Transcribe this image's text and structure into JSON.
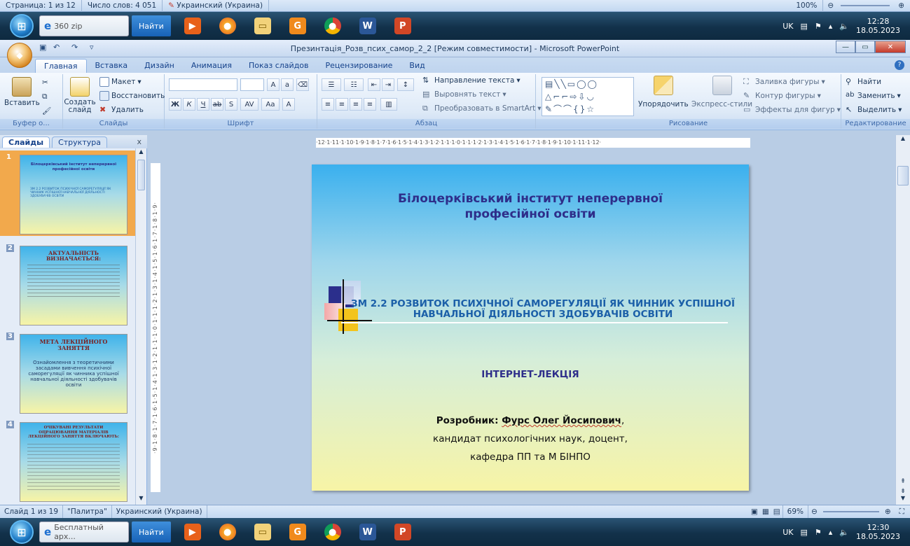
{
  "top_status": {
    "page": "Страница: 1 из 12",
    "words": "Число слов: 4 051",
    "language": "Украинский (Украина)",
    "zoom": "100%"
  },
  "taskbar_top": {
    "search_value": "360 zip",
    "search_button": "Найти",
    "tray_lang": "UK",
    "time": "12:28",
    "date": "18.05.2023"
  },
  "window": {
    "title": "Презинтація_Розв_псих_самор_2_2 [Режим совместимости] - Microsoft PowerPoint"
  },
  "ribbon_tabs": [
    "Главная",
    "Вставка",
    "Дизайн",
    "Анимация",
    "Показ слайдов",
    "Рецензирование",
    "Вид"
  ],
  "ribbon": {
    "paste": "Вставить",
    "clipboard_group": "Буфер о...",
    "layout": "Макет",
    "reset": "Восстановить",
    "new_slide": "Создать слайд",
    "delete": "Удалить",
    "slides_group": "Слайды",
    "font_group": "Шрифт",
    "text_direction": "Направление текста",
    "align_text": "Выровнять текст",
    "smartart": "Преобразовать в SmartArt",
    "paragraph_group": "Абзац",
    "arrange": "Упорядочить",
    "quick_styles": "Экспресс-стили",
    "shape_fill": "Заливка фигуры",
    "shape_outline": "Контур фигуры",
    "shape_effects": "Эффекты для фигур",
    "drawing_group": "Рисование",
    "find": "Найти",
    "replace": "Заменить",
    "select": "Выделить",
    "editing_group": "Редактирование"
  },
  "panel": {
    "tab_slides": "Слайды",
    "tab_outline": "Структура",
    "close": "x"
  },
  "thumbnails": [
    {
      "num": "1",
      "title": "Білоцерківський інститут неперервної професійної освіти",
      "text": "ЗМ 2.2 РОЗВИТОК ПСИХІЧНОЇ САМОРЕГУЛЯЦІЇ ЯК ЧИННИК УСПІШНОЇ НАВЧАЛЬНОЇ ДІЯЛЬНОСТІ ЗДОБУВАЧІВ ОСВІТИ"
    },
    {
      "num": "2",
      "title": "АКТУАЛЬНІСТЬ ВИЗНАЧАЄТЬСЯ:",
      "text": ""
    },
    {
      "num": "3",
      "title": "МЕТА ЛЕКЦІЙНОГО ЗАНЯТТЯ",
      "text": "Ознайомлення з теоретичними засадами вивчення психічної саморегуляції як чинника успішної навчальної діяльності здобувачів освіти"
    },
    {
      "num": "4",
      "title": "ОЧІКУВАНІ РЕЗУЛЬТАТИ ОПРАЦЮВАННЯ МАТЕРІАЛІВ ЛЕКЦІЙНОГО ЗАНЯТТЯ ВКЛЮЧАЮТЬ:",
      "text": ""
    }
  ],
  "ruler_h": "·12·1·11·1·10·1·9·1·8·1·7·1·6·1·5·1·4·1·3·1·2·1·1·1·0·1·1·1·2·1·3·1·4·1·5·1·6·1·7·1·8·1·9·1·10·1·11·1·12·",
  "ruler_v": "·9·1·8·1·7·1·6·1·5·1·4·1·3·1·2·1·1·1·0·1·1·1·2·1·3·1·4·1·5·1·6·1·7·1·8·1·9·",
  "slide": {
    "title": "Білоцерківський інститут неперервної професійної освіти",
    "topic": "ЗМ 2.2 РОЗВИТОК ПСИХІЧНОЇ САМОРЕГУЛЯЦІЇ ЯК ЧИННИК УСПІШНОЇ НАВЧАЛЬНОЇ ДІЯЛЬНОСТІ ЗДОБУВАЧІВ ОСВІТИ",
    "format": "ІНТЕРНЕТ-ЛЕКЦІЯ",
    "author_label": "Розробник: ",
    "author_name": "Фурс Олег Йосипович",
    "author_comma": ",",
    "degree": "кандидат психологічних наук, доцент,",
    "department": "кафедра ПП та М БІНПО"
  },
  "status": {
    "slide": "Слайд 1 из 19",
    "theme": "\"Палитра\"",
    "language": "Украинский (Украина)",
    "zoom": "69%"
  },
  "taskbar_bottom": {
    "task_label": "Бесплатный арх...",
    "search_button": "Найти",
    "tray_lang": "UK",
    "time": "12:30",
    "date": "18.05.2023"
  }
}
